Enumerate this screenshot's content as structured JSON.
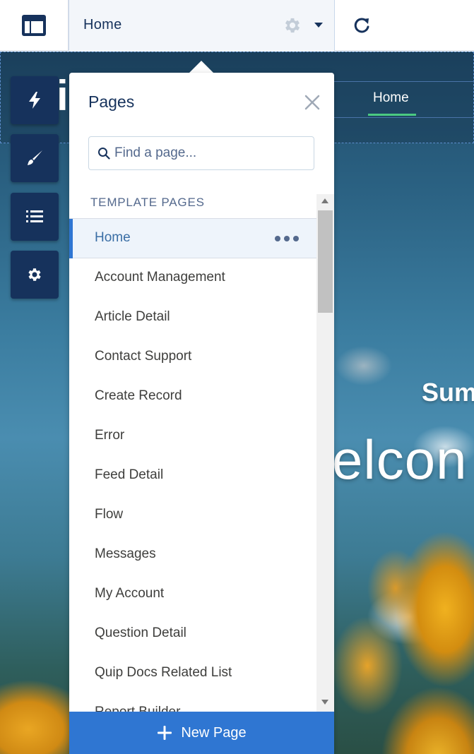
{
  "topbar": {
    "page_selector_label": "Home"
  },
  "site": {
    "logo_letter": "i",
    "nav_home": "Home",
    "hero_subtitle": "Sum",
    "hero_title": "elcon"
  },
  "panel": {
    "title": "Pages",
    "search_placeholder": "Find a page...",
    "section_label": "TEMPLATE PAGES",
    "items": [
      {
        "label": "Home"
      },
      {
        "label": "Account Management"
      },
      {
        "label": "Article Detail"
      },
      {
        "label": "Contact Support"
      },
      {
        "label": "Create Record"
      },
      {
        "label": "Error"
      },
      {
        "label": "Feed Detail"
      },
      {
        "label": "Flow"
      },
      {
        "label": "Messages"
      },
      {
        "label": "My Account"
      },
      {
        "label": "Question Detail"
      },
      {
        "label": "Quip Docs Related List"
      },
      {
        "label": "Report Builder"
      }
    ],
    "new_page_label": "New Page"
  },
  "colors": {
    "navy": "#16325c",
    "accent_blue": "#2f76d2",
    "nav_underline": "#4bca81"
  }
}
